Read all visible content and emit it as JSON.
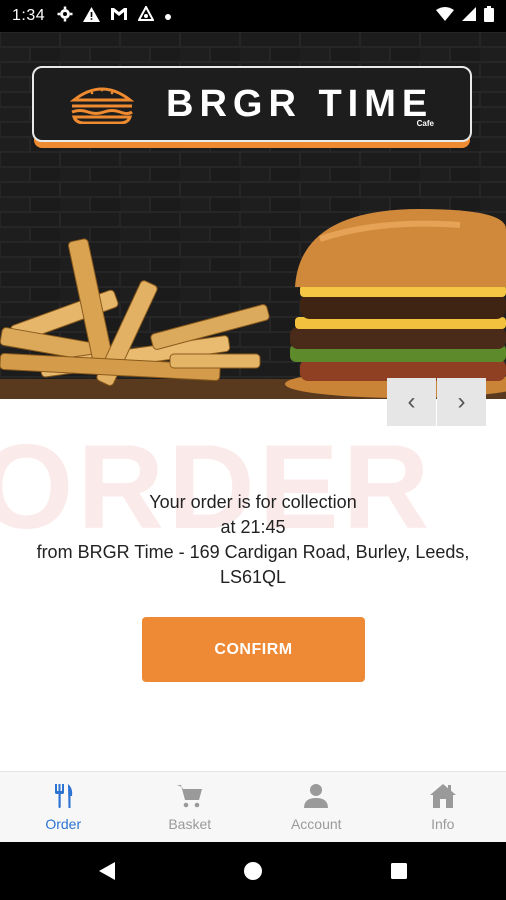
{
  "status_bar": {
    "time": "1:34",
    "left_icons": [
      "gear-icon",
      "warning-icon",
      "gmail-icon",
      "vpn-icon",
      "dot-icon"
    ],
    "right_icons": [
      "wifi-icon",
      "signal-icon",
      "battery-icon"
    ]
  },
  "hero": {
    "brand": "BRGR TIME",
    "brand_sub": "Cafe",
    "nav_prev": "‹",
    "nav_next": "›"
  },
  "watermark": "ORDER",
  "message": {
    "line1": "Your order is for collection",
    "line2": "at 21:45",
    "line3": "from BRGR Time - 169 Cardigan Road, Burley, Leeds,",
    "line4": "LS61QL"
  },
  "confirm_label": "CONFIRM",
  "colors": {
    "accent": "#ee8a35",
    "active_tab": "#2c73d2",
    "inactive_tab": "#9a9a9a"
  },
  "bottom_nav": [
    {
      "label": "Order",
      "icon": "fork-knife-icon",
      "active": true
    },
    {
      "label": "Basket",
      "icon": "cart-icon",
      "active": false
    },
    {
      "label": "Account",
      "icon": "person-icon",
      "active": false
    },
    {
      "label": "Info",
      "icon": "home-icon",
      "active": false
    }
  ]
}
